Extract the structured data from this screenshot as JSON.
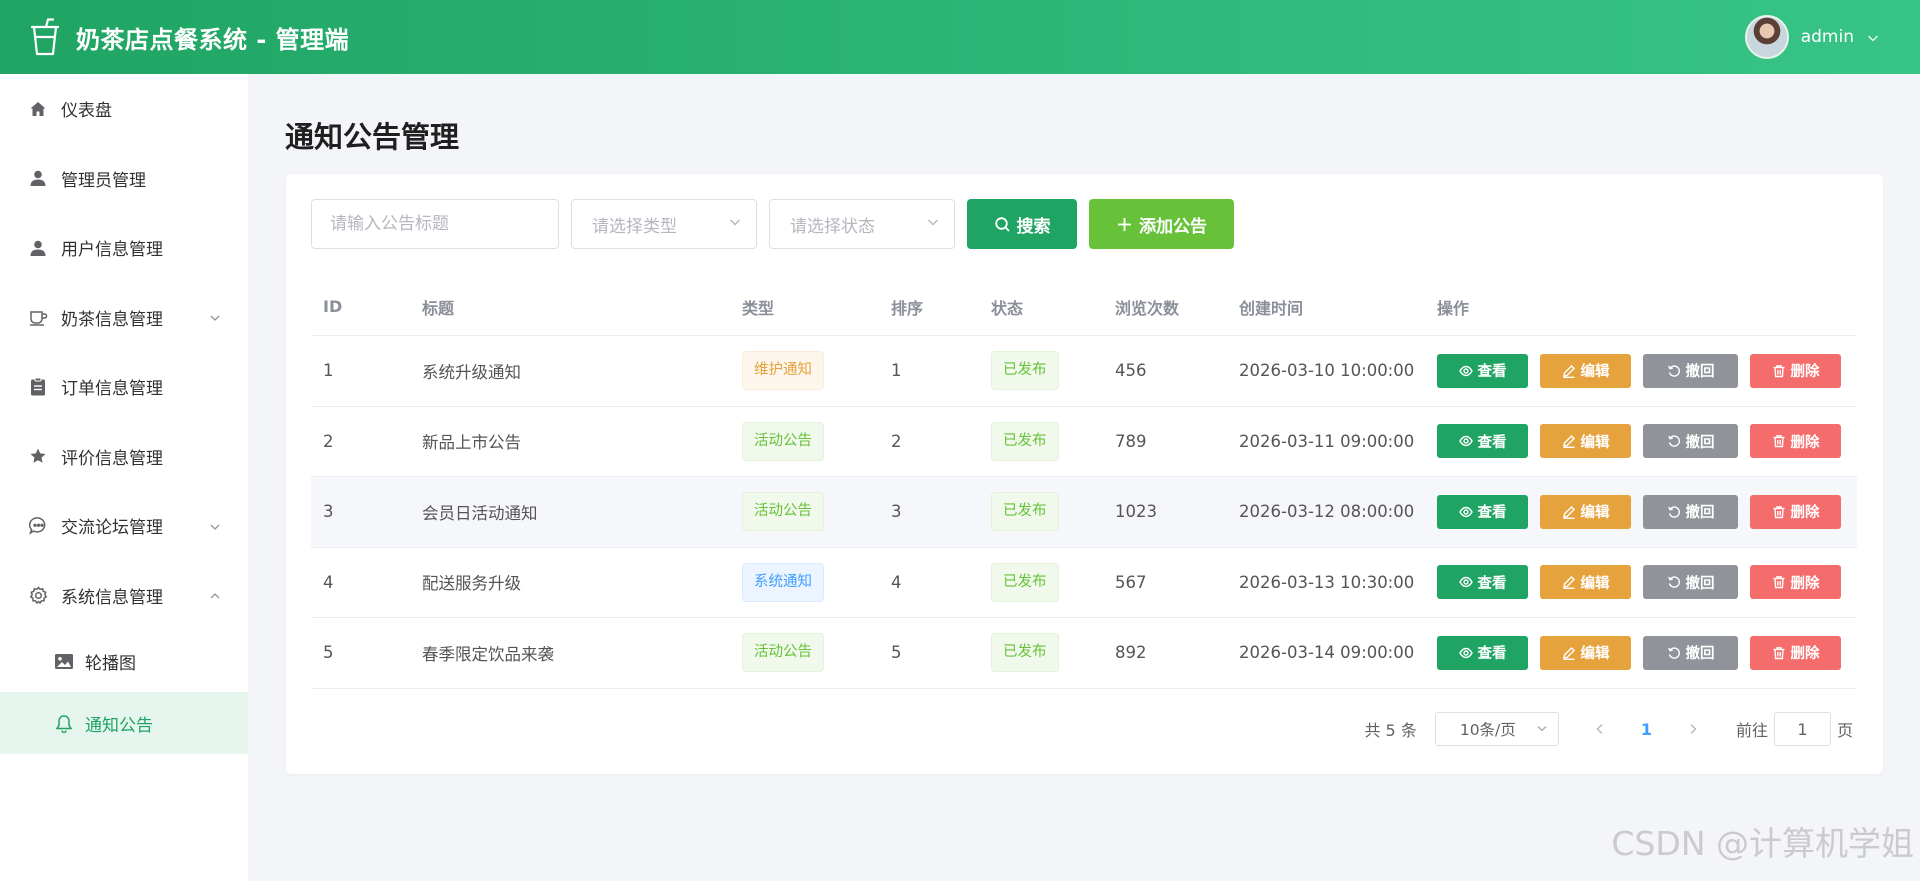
{
  "header": {
    "title": "奶茶店点餐系统 - 管理端",
    "user_name": "admin"
  },
  "sidebar": {
    "items": [
      {
        "label": "仪表盘",
        "icon": "home-icon"
      },
      {
        "label": "管理员管理",
        "icon": "user-icon"
      },
      {
        "label": "用户信息管理",
        "icon": "user-icon"
      },
      {
        "label": "奶茶信息管理",
        "icon": "cup-icon",
        "expanded": false
      },
      {
        "label": "订单信息管理",
        "icon": "clipboard-icon"
      },
      {
        "label": "评价信息管理",
        "icon": "star-icon"
      },
      {
        "label": "交流论坛管理",
        "icon": "chat-icon",
        "expanded": false
      },
      {
        "label": "系统信息管理",
        "icon": "gear-icon",
        "expanded": true
      }
    ],
    "subitems": [
      {
        "label": "轮播图",
        "icon": "picture-icon"
      },
      {
        "label": "通知公告",
        "icon": "bell-icon",
        "active": true
      }
    ]
  },
  "page": {
    "title": "通知公告管理"
  },
  "toolbar": {
    "title_placeholder": "请输入公告标题",
    "type_placeholder": "请选择类型",
    "status_placeholder": "请选择状态",
    "search_label": "搜索",
    "add_label": "添加公告"
  },
  "table": {
    "headers": {
      "id": "ID",
      "title": "标题",
      "type": "类型",
      "sort": "排序",
      "status": "状态",
      "views": "浏览次数",
      "time": "创建时间",
      "ops": "操作"
    },
    "op_labels": {
      "view": "查看",
      "edit": "编辑",
      "revoke": "撤回",
      "delete": "删除"
    },
    "rows": [
      {
        "id": "1",
        "title": "系统升级通知",
        "type": "维护通知",
        "type_color": "orange",
        "sort": "1",
        "status": "已发布",
        "views": "456",
        "time": "2026-03-10 10:00:00"
      },
      {
        "id": "2",
        "title": "新品上市公告",
        "type": "活动公告",
        "type_color": "green",
        "sort": "2",
        "status": "已发布",
        "views": "789",
        "time": "2026-03-11 09:00:00"
      },
      {
        "id": "3",
        "title": "会员日活动通知",
        "type": "活动公告",
        "type_color": "green",
        "sort": "3",
        "status": "已发布",
        "views": "1023",
        "time": "2026-03-12 08:00:00"
      },
      {
        "id": "4",
        "title": "配送服务升级",
        "type": "系统通知",
        "type_color": "blue",
        "sort": "4",
        "status": "已发布",
        "views": "567",
        "time": "2026-03-13 10:30:00"
      },
      {
        "id": "5",
        "title": "春季限定饮品来袭",
        "type": "活动公告",
        "type_color": "green",
        "sort": "5",
        "status": "已发布",
        "views": "892",
        "time": "2026-03-14 09:00:00"
      }
    ]
  },
  "pagination": {
    "total_text": "共 5 条",
    "page_size": "10条/页",
    "current_page": "1",
    "goto_label": "前往",
    "goto_value": "1",
    "page_suffix": "页"
  },
  "watermark": "CSDN @计算机学姐",
  "colors": {
    "primary": "#1fa463",
    "add": "#67c23a",
    "edit": "#e6a23c",
    "revoke": "#909399",
    "delete": "#f56c6c"
  }
}
